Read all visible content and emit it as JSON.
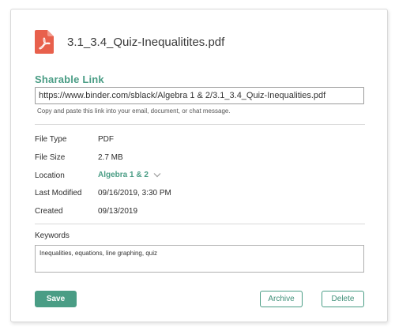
{
  "colors": {
    "accent": "#4a9d85",
    "pdf_icon": "#e8604c",
    "pointer_arrow": "#cf968f"
  },
  "file": {
    "icon": "pdf-file-icon",
    "title": "3.1_3.4_Quiz-Inequalitites.pdf"
  },
  "sharable_link": {
    "title": "Sharable Link",
    "url": "https://www.binder.com/sblack/Algebra 1 & 2/3.1_3.4_Quiz-Inequalities.pdf",
    "help": "Copy and paste this link into your email, document, or chat message."
  },
  "properties": [
    {
      "label": "File Type",
      "value": "PDF"
    },
    {
      "label": "File Size",
      "value": "2.7 MB"
    },
    {
      "label": "Location",
      "value": "Algebra 1 & 2"
    },
    {
      "label": "Last Modified",
      "value": "09/16/2019, 3:30 PM"
    },
    {
      "label": "Created",
      "value": "09/13/2019"
    }
  ],
  "keywords": {
    "label": "Keywords",
    "value": "Inequalities, equations, line graphing, quiz"
  },
  "actions": {
    "save": "Save",
    "archive": "Archive",
    "delete": "Delete"
  }
}
